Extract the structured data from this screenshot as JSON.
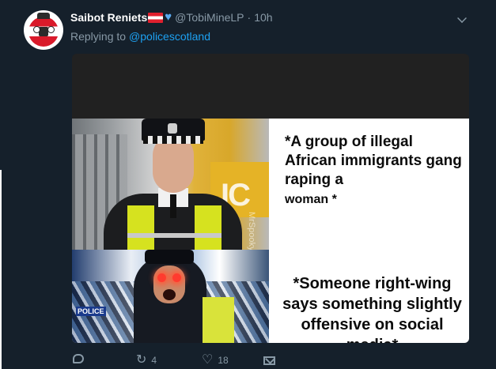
{
  "tweet": {
    "author_name": "Saibot Reniets",
    "handle": "@TobiMineLP",
    "separator": "·",
    "time": "10h",
    "reply_prefix": "Replying to",
    "reply_to": "@policescotland"
  },
  "media": {
    "caption_top": "*A group of illegal African immigrants gang raping a",
    "caption_top_last": "woman *",
    "caption_bottom": "*Someone right-wing says something slightly offensive on social media*",
    "watermark": "MrSpooky",
    "photo_top_sign": "IC",
    "photo_bottom_sign": "POLICE"
  },
  "actions": {
    "replies": "",
    "retweets": "4",
    "likes": "18"
  },
  "icons": {
    "reply": "reply-icon",
    "retweet": "retweet-icon",
    "like": "heart-icon",
    "dm": "envelope-icon",
    "caret": "chevron-down-icon",
    "flag": "austria-flag-icon",
    "verified_heart": "blue-heart-icon"
  },
  "colors": {
    "background": "#15202b",
    "secondary_text": "#8899a6",
    "link": "#1da1f2"
  }
}
